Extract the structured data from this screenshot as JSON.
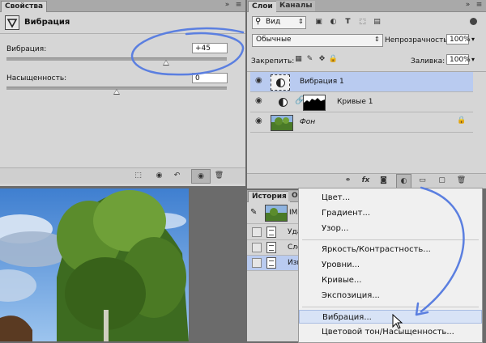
{
  "properties": {
    "tab": "Свойства",
    "header": "Вибрация",
    "vibrance_label": "Вибрация:",
    "vibrance_value": "+45",
    "saturation_label": "Насыщенность:",
    "saturation_value": "0",
    "vibrance_slider": 0.725,
    "saturation_slider": 0.5
  },
  "layers": {
    "tabs": [
      "Слои",
      "Каналы"
    ],
    "filter_label": "Вид",
    "blend_mode": "Обычные",
    "opacity_label": "Непрозрачность:",
    "opacity_value": "100%",
    "lock_label": "Закрепить:",
    "fill_label": "Заливка:",
    "fill_value": "100%",
    "rows": [
      {
        "name": "Вибрация 1"
      },
      {
        "name": "Кривые 1"
      },
      {
        "name": "Фон"
      }
    ],
    "footer_icons": [
      "link-icon",
      "fx-icon",
      "mask-icon",
      "adjustment-icon",
      "folder-icon",
      "new-layer-icon",
      "trash-icon"
    ]
  },
  "history": {
    "tabs": [
      "История",
      "Оп"
    ],
    "snapshot_label": "IM",
    "rows": [
      "Уда",
      "Сло",
      "Изм"
    ]
  },
  "menu": {
    "items": [
      "Цвет...",
      "Градиент...",
      "Узор...",
      "Яркость/Контрастность...",
      "Уровни...",
      "Кривые...",
      "Экспозиция...",
      "Вибрация...",
      "Цветовой тон/Насыщенность..."
    ]
  },
  "colors": {
    "panel_bg": "#d6d6d6",
    "selected_row": "#b9cbf0",
    "annotation": "#5b7fe0"
  }
}
